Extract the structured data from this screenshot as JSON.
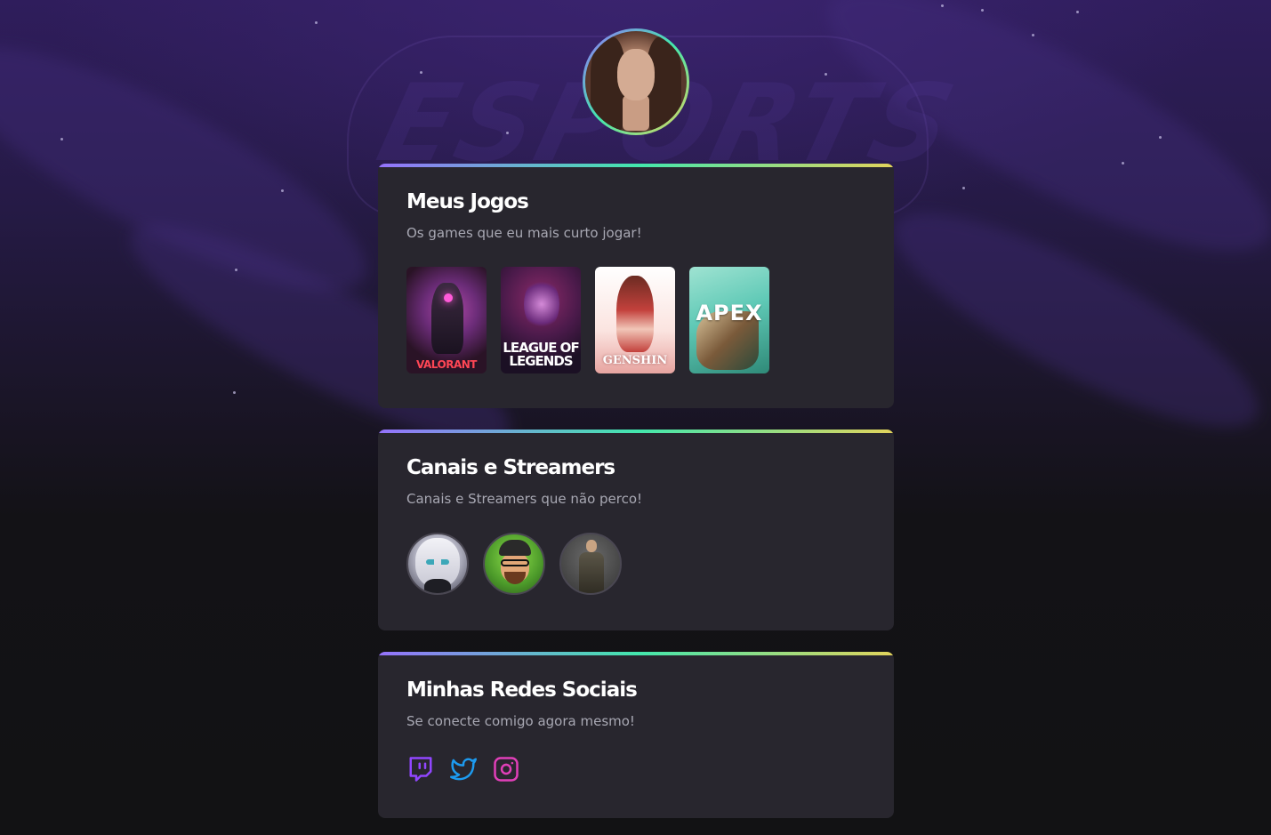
{
  "background": {
    "watermark_text": "ESPORTS"
  },
  "profile": {
    "avatar_alt": "Foto de perfil"
  },
  "games_card": {
    "title": "Meus Jogos",
    "subtitle": "Os games que eu mais curto jogar!",
    "games": [
      {
        "name": "VALORANT"
      },
      {
        "name": "LEAGUE OF LEGENDS"
      },
      {
        "name": "GENSHIN"
      },
      {
        "name": "APEX"
      }
    ]
  },
  "streamers_card": {
    "title": "Canais e Streamers",
    "subtitle": "Canais e Streamers que não perco!",
    "streamers_count": 3
  },
  "social_card": {
    "title": "Minhas Redes Sociais",
    "subtitle": "Se conecte comigo agora mesmo!",
    "networks": [
      {
        "icon": "twitch-icon",
        "color": "#9146ff"
      },
      {
        "icon": "twitter-icon",
        "color": "#1d9bf0"
      },
      {
        "icon": "instagram-icon",
        "color": "#e03fb8"
      }
    ]
  },
  "colors": {
    "gradient_start": "#9572fc",
    "gradient_mid": "#43e7ad",
    "gradient_end": "#e2d45c",
    "card_bg": "#28262e"
  }
}
